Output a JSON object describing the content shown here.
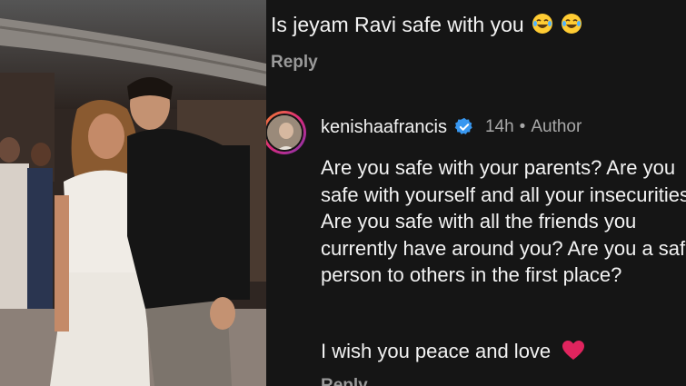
{
  "photo": {
    "alt_subject": "photo-of-two-people"
  },
  "top_comment": {
    "text": "Is jeyam Ravi safe with you",
    "emoji": "laughing-emoji",
    "reply_label": "Reply"
  },
  "comment": {
    "username": "kenishaafrancis",
    "time": "14h",
    "badge": "Author",
    "body": "Are you safe with your parents? Are you safe with yourself and all your insecurities? Are you safe with all the friends you currently have around you? Are you a safe person to others in the first place?",
    "closing": "I wish you peace and love",
    "reply_label": "Reply"
  },
  "colors": {
    "panel_bg": "#151515",
    "verified_blue": "#3897f0",
    "heart_red": "#e0245e"
  }
}
